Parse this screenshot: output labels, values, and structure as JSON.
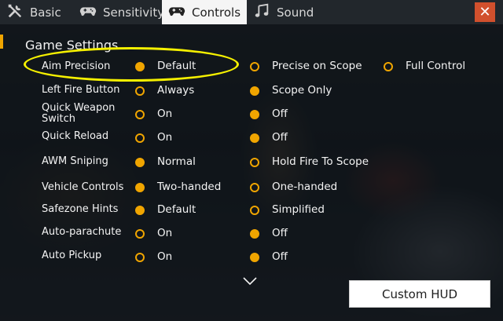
{
  "tabs": [
    {
      "label": "Basic",
      "icon": "tools-icon",
      "active": false
    },
    {
      "label": "Sensitivity",
      "icon": "gamepad-icon",
      "active": false
    },
    {
      "label": "Controls",
      "icon": "gamepad-icon",
      "active": true
    },
    {
      "label": "Sound",
      "icon": "music-note-icon",
      "active": false
    }
  ],
  "section_title": "Game Settings",
  "accent_color": "#f0a500",
  "close_color": "#d1502d",
  "settings": [
    {
      "label": "Aim Precision",
      "options": [
        "Default",
        "Precise on Scope",
        "Full Control"
      ],
      "selected": 0
    },
    {
      "label": "Left Fire Button",
      "options": [
        "Always",
        "Scope Only"
      ],
      "selected": 1
    },
    {
      "label": "Quick Weapon Switch",
      "options": [
        "On",
        "Off"
      ],
      "selected": 1
    },
    {
      "label": "Quick Reload",
      "options": [
        "On",
        "Off"
      ],
      "selected": 1
    },
    {
      "label": "AWM Sniping",
      "options": [
        "Normal",
        "Hold Fire To Scope"
      ],
      "selected": 0
    },
    {
      "label": "Vehicle Controls",
      "options": [
        "Two-handed",
        "One-handed"
      ],
      "selected": 0
    },
    {
      "label": "Safezone Hints",
      "options": [
        "Default",
        "Simplified"
      ],
      "selected": 0
    },
    {
      "label": "Auto-parachute",
      "options": [
        "On",
        "Off"
      ],
      "selected": 1
    },
    {
      "label": "Auto Pickup",
      "options": [
        "On",
        "Off"
      ],
      "selected": 1
    }
  ],
  "custom_hud_label": "Custom HUD"
}
